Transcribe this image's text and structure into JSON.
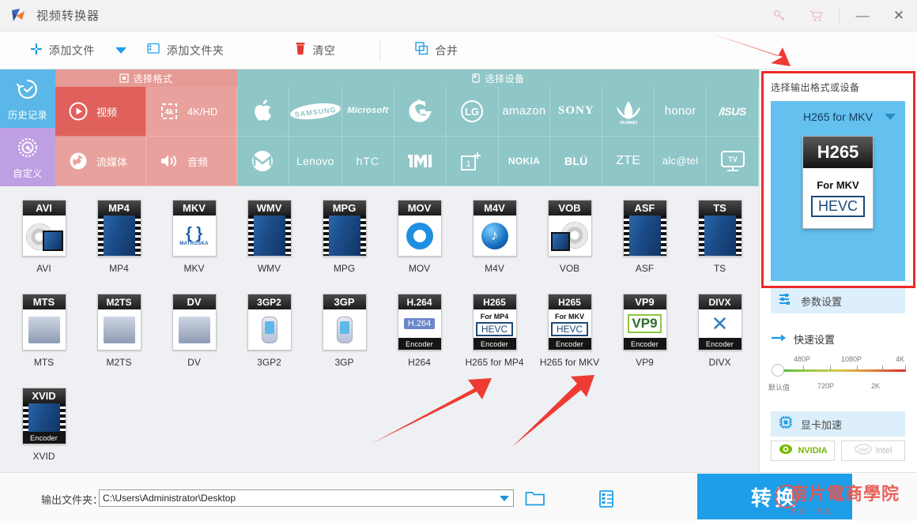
{
  "window": {
    "title": "视频转换器",
    "logo_icon": "app-logo-icon",
    "controls": {
      "key_icon": "key-icon",
      "cart_icon": "cart-icon",
      "minimize": "—",
      "close": "✕"
    }
  },
  "toolbar": {
    "add_file": "添加文件",
    "add_file_dropdown_icon": "caret-down-icon",
    "add_folder": "添加文件夹",
    "add_folder_icon": "folder-icon",
    "clear": "清空",
    "clear_icon": "trash-icon",
    "merge": "合并",
    "merge_icon": "merge-icon"
  },
  "sidebar": {
    "items": [
      {
        "label": "历史记录",
        "icon": "history-icon"
      },
      {
        "label": "自定义",
        "icon": "gear-icon"
      }
    ]
  },
  "category": {
    "format_header": "选择格式",
    "format_header_icon": "document-icon",
    "device_header": "选择设备",
    "device_header_icon": "device-icon",
    "format_tabs": [
      {
        "label": "视频",
        "icon": "play-icon",
        "active": true
      },
      {
        "label": "4K/HD",
        "icon": "4k-icon",
        "active": false
      },
      {
        "label": "流媒体",
        "icon": "stream-icon",
        "active": false
      },
      {
        "label": "音频",
        "icon": "speaker-icon",
        "active": false
      }
    ],
    "devices_row1": [
      "Apple",
      "SAMSUNG",
      "Microsoft",
      "G",
      "LG",
      "amazon",
      "SONY",
      "HUAWEI",
      "honor",
      "ASUS"
    ],
    "devices_row2": [
      "Motorola",
      "Lenovo",
      "HTC",
      "MI",
      "OnePlus",
      "NOKIA",
      "BLU",
      "ZTE",
      "alcatel",
      "TV"
    ]
  },
  "formats": {
    "rows": [
      [
        {
          "label": "AVI",
          "badge": "AVI",
          "art": "disc-film",
          "footer": ""
        },
        {
          "label": "MP4",
          "badge": "MP4",
          "art": "film",
          "footer": ""
        },
        {
          "label": "MKV",
          "badge": "MKV",
          "art": "matroska",
          "footer": "",
          "sub": "MATROSKA"
        },
        {
          "label": "WMV",
          "badge": "WMV",
          "art": "film",
          "footer": ""
        },
        {
          "label": "MPG",
          "badge": "MPG",
          "art": "film",
          "footer": ""
        },
        {
          "label": "MOV",
          "badge": "MOV",
          "art": "quicktime",
          "footer": ""
        },
        {
          "label": "M4V",
          "badge": "M4V",
          "art": "itunes",
          "footer": ""
        },
        {
          "label": "VOB",
          "badge": "VOB",
          "art": "disc-film",
          "footer": ""
        },
        {
          "label": "ASF",
          "badge": "ASF",
          "art": "film",
          "footer": ""
        },
        {
          "label": "TS",
          "badge": "TS",
          "art": "film",
          "footer": ""
        }
      ],
      [
        {
          "label": "MTS",
          "badge": "MTS",
          "art": "camera",
          "footer": ""
        },
        {
          "label": "M2TS",
          "badge": "M2TS",
          "art": "camera",
          "footer": ""
        },
        {
          "label": "DV",
          "badge": "DV",
          "art": "camera",
          "footer": ""
        },
        {
          "label": "3GP2",
          "badge": "3GP2",
          "art": "phone",
          "footer": ""
        },
        {
          "label": "3GP",
          "badge": "3GP",
          "art": "phone",
          "footer": ""
        },
        {
          "label": "H264",
          "badge": "H.264",
          "art": "h264chip",
          "footer": "Encoder",
          "chip": "H.264"
        },
        {
          "label": "H265 for MP4",
          "badge": "H265",
          "art": "hevc",
          "footer": "Encoder",
          "sub": "For MP4",
          "chip": "HEVC"
        },
        {
          "label": "H265 for MKV",
          "badge": "H265",
          "art": "hevc",
          "footer": "Encoder",
          "sub": "For MKV",
          "chip": "HEVC"
        },
        {
          "label": "VP9",
          "badge": "VP9",
          "art": "vp9",
          "footer": "Encoder",
          "chip": "VP9"
        },
        {
          "label": "DIVX",
          "badge": "DIVX",
          "art": "divx",
          "footer": "Encoder"
        }
      ],
      [
        {
          "label": "XVID",
          "badge": "XVID",
          "art": "film",
          "footer": "Encoder"
        }
      ]
    ]
  },
  "right_panel": {
    "title": "选择输出格式或设备",
    "selected_format": "H265 for MKV",
    "selected_badge": "H265",
    "selected_sub": "For MKV",
    "selected_chip": "HEVC",
    "dropdown_icon": "caret-down-icon",
    "param_settings": "参数设置",
    "param_settings_icon": "sliders-icon",
    "quick_settings": "快速设置",
    "quick_settings_icon": "arrow-right-icon",
    "slider": {
      "top_labels": [
        "480P",
        "1080P",
        "4K"
      ],
      "bottom_labels": [
        "默认值",
        "720P",
        "2K"
      ],
      "value": "默认值"
    },
    "gpu_accel": "显卡加速",
    "gpu_accel_icon": "chip-icon",
    "gpu_buttons": [
      {
        "label": "NVIDIA",
        "icon": "nvidia-icon",
        "enabled": true
      },
      {
        "label": "Intel",
        "icon": "intel-icon",
        "enabled": false
      }
    ]
  },
  "bottom": {
    "output_folder_label": "输出文件夹：",
    "output_folder_value": "C:\\Users\\Administrator\\Desktop",
    "folder_icon": "folder-open-icon",
    "open_icon": "open-file-icon",
    "convert_button": "转换"
  },
  "watermark": {
    "text": "南片電商學院",
    "sub": "专注 · 专业"
  },
  "colors": {
    "accent_blue": "#1e9ee8",
    "panel_blue": "#64c0ef",
    "format_red": "#e0605c",
    "device_teal": "#8fc6c7",
    "history_blue": "#5ab7e8",
    "custom_purple": "#bf9fe3",
    "highlight_red": "#ec2b26"
  }
}
